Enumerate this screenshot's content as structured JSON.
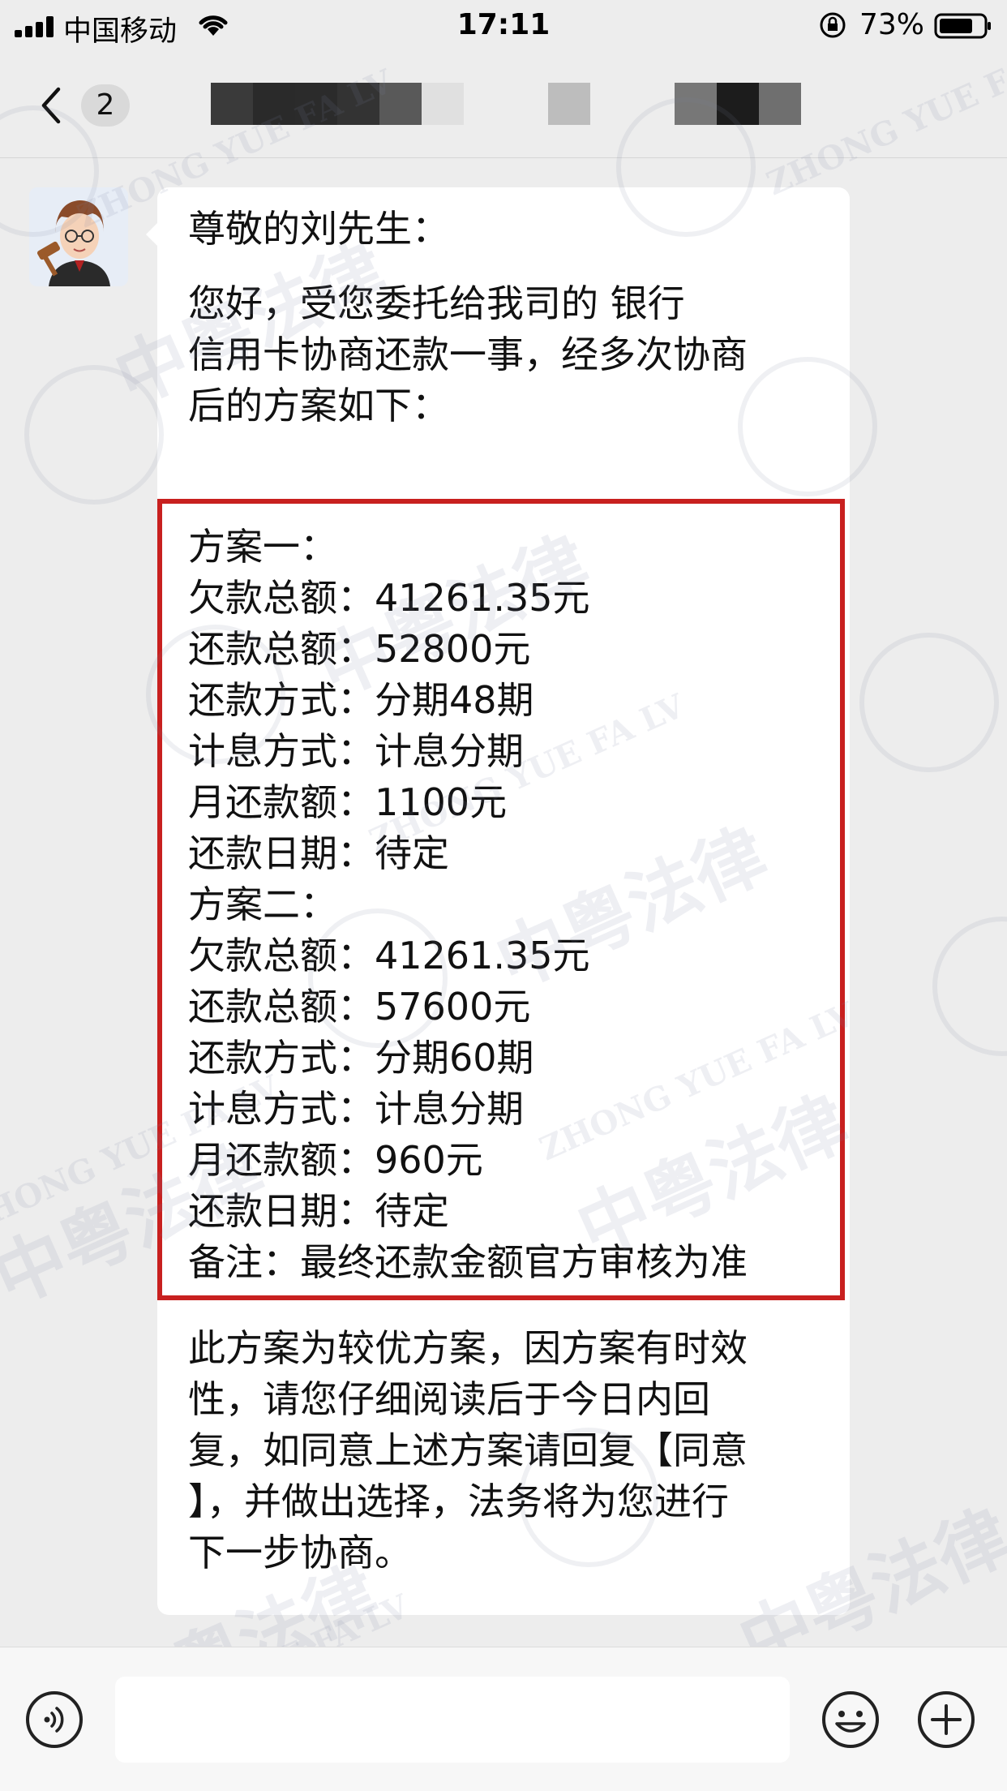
{
  "status_bar": {
    "carrier": "中国移动",
    "time": "17:11",
    "battery_percent": "73%",
    "icons": [
      "signal-icon",
      "wifi-icon",
      "rotation-lock-icon",
      "battery-icon"
    ]
  },
  "nav": {
    "unread_count": "2",
    "icons": [
      "chevron-left-icon"
    ]
  },
  "message": {
    "sender_avatar": "lawyer-cartoon-avatar",
    "greeting": "尊敬的刘先生：",
    "intro_lines": [
      "您好，受您委托给我司的        银行",
      "信用卡协商还款一事，经多次协商",
      "后的方案如下："
    ],
    "plans_lines": [
      "方案一：",
      "欠款总额：41261.35元",
      "还款总额：52800元",
      "还款方式：分期48期",
      "计息方式：计息分期",
      "月还款额：1100元",
      "还款日期：待定",
      "方案二：",
      "欠款总额：41261.35元",
      "还款总额：57600元",
      "还款方式：分期60期",
      "计息方式：计息分期",
      "月还款额：960元",
      "还款日期：待定",
      "备注：最终还款金额官方审核为准"
    ],
    "closing_lines": [
      "此方案为较优方案，因方案有时效",
      "性，请您仔细阅读后于今日内回",
      "复，如同意上述方案请回复【同意",
      "】，并做出选择，法务将为您进行",
      "下一步协商。"
    ],
    "highlight_color": "#c8201f"
  },
  "watermark": {
    "text_cn": "中粤法律",
    "text_en": "ZHONG YUE FA LV"
  },
  "input_bar": {
    "placeholder": "",
    "icons": [
      "voice-icon",
      "emoji-icon",
      "plus-icon"
    ]
  }
}
